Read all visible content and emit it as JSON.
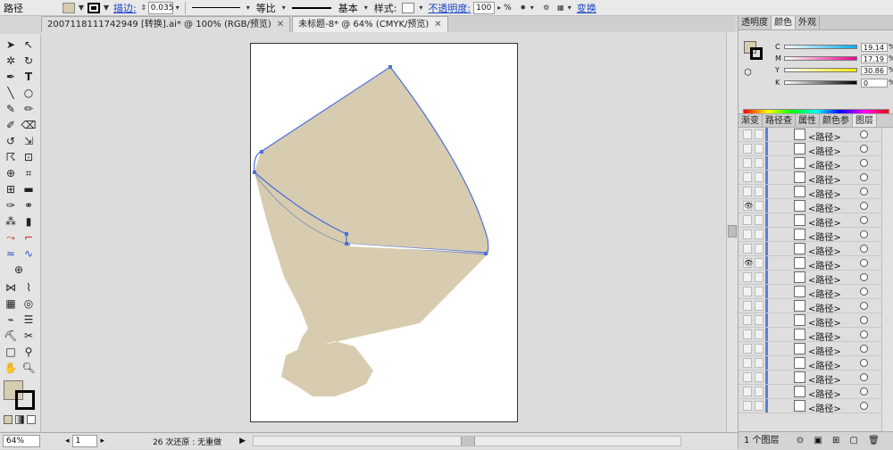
{
  "control_bar": {
    "selection_label": "路径",
    "stroke_label": "描边:",
    "stroke_weight": "0.035",
    "profile_label": "等比",
    "brush_label": "基本",
    "style_label": "样式:",
    "opacity_label": "不透明度:",
    "opacity_value": "100",
    "opacity_unit": "%",
    "transform_label": "变换"
  },
  "tabs": [
    {
      "label": "20071181117429​49 [转换].ai* @ 100% (RGB/预览)"
    },
    {
      "label": "未标题-8* @ 64% (CMYK/预览)"
    }
  ],
  "status_bar": {
    "zoom": "64%",
    "page": "1",
    "history_text": "26 次还原 : 无重做"
  },
  "color_panel": {
    "tabs": [
      "透明度",
      "颜色",
      "外观"
    ],
    "channels": [
      {
        "key": "C",
        "value": "19.14",
        "unit": "%"
      },
      {
        "key": "M",
        "value": "17.19",
        "unit": "%"
      },
      {
        "key": "Y",
        "value": "30.86",
        "unit": "%"
      },
      {
        "key": "K",
        "value": "0",
        "unit": "%"
      }
    ]
  },
  "layers_panel": {
    "tabs": [
      "渐变",
      "路径查",
      "属性",
      "颜色参",
      "图层"
    ],
    "item_label": "<路径>",
    "footer_label": "1 个图层",
    "rows": [
      {
        "visible": false
      },
      {
        "visible": false
      },
      {
        "visible": false
      },
      {
        "visible": false
      },
      {
        "visible": false
      },
      {
        "visible": true
      },
      {
        "visible": false
      },
      {
        "visible": false
      },
      {
        "visible": false
      },
      {
        "visible": true
      },
      {
        "visible": false
      },
      {
        "visible": false
      },
      {
        "visible": false
      },
      {
        "visible": false
      },
      {
        "visible": false
      },
      {
        "visible": false
      },
      {
        "visible": false
      },
      {
        "visible": false
      },
      {
        "visible": false
      },
      {
        "visible": false
      }
    ]
  },
  "colors": {
    "fill": "#d8ccb0",
    "selection": "#4a6fdc",
    "accent_link": "#1d44c8"
  }
}
